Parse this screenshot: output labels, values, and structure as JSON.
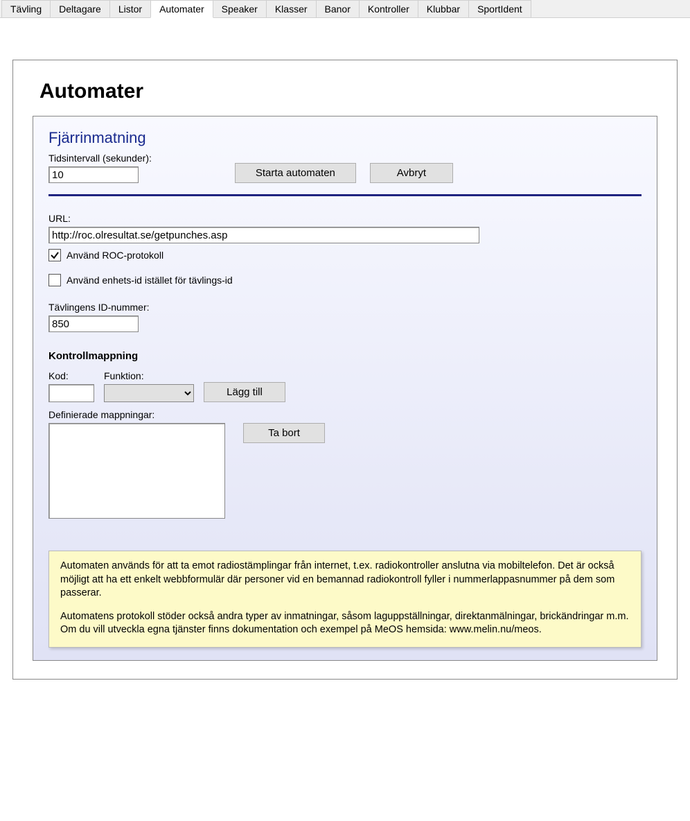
{
  "tabs": [
    {
      "label": "Tävling",
      "active": false
    },
    {
      "label": "Deltagare",
      "active": false
    },
    {
      "label": "Listor",
      "active": false
    },
    {
      "label": "Automater",
      "active": true
    },
    {
      "label": "Speaker",
      "active": false
    },
    {
      "label": "Klasser",
      "active": false
    },
    {
      "label": "Banor",
      "active": false
    },
    {
      "label": "Kontroller",
      "active": false
    },
    {
      "label": "Klubbar",
      "active": false
    },
    {
      "label": "SportIdent",
      "active": false
    }
  ],
  "page_title": "Automater",
  "panel_title": "Fjärrinmatning",
  "interval": {
    "label": "Tidsintervall (sekunder):",
    "value": "10"
  },
  "buttons": {
    "start": "Starta automaten",
    "cancel": "Avbryt",
    "add": "Lägg till",
    "remove": "Ta bort"
  },
  "url": {
    "label": "URL:",
    "value": "http://roc.olresultat.se/getpunches.asp"
  },
  "checkboxes": {
    "roc": {
      "label": "Använd ROC-protokoll",
      "checked": true
    },
    "device_id": {
      "label": "Använd enhets-id istället för tävlings-id",
      "checked": false
    }
  },
  "competition_id": {
    "label": "Tävlingens ID-nummer:",
    "value": "850"
  },
  "mapping": {
    "heading": "Kontrollmappning",
    "kod_label": "Kod:",
    "funktion_label": "Funktion:",
    "defined_label": "Definierade mappningar:"
  },
  "info": {
    "p1": "Automaten används för att ta emot radiostämplingar från internet, t.ex. radiokontroller anslutna via mobiltelefon. Det är också möjligt att ha ett enkelt webbformulär där personer vid en bemannad radiokontroll fyller i nummerlappasnummer på dem som passerar.",
    "p2": "Automatens protokoll stöder också andra typer av inmatningar, såsom laguppställningar, direktanmälningar, brickändringar m.m. Om du vill utveckla egna tjänster finns dokumentation och exempel på MeOS hemsida: www.melin.nu/meos."
  }
}
